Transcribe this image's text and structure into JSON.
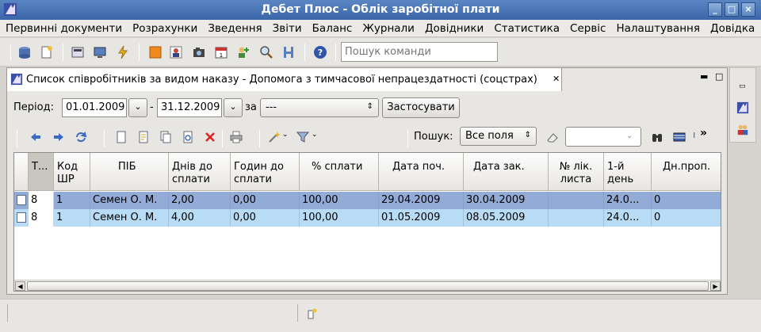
{
  "window": {
    "title": "Дебет Плюс - Облік заробітної плати",
    "controls": [
      "minimize-icon",
      "maximize-icon",
      "close-icon"
    ]
  },
  "menu": [
    "Первинні документи",
    "Розрахунки",
    "Зведення",
    "Звіти",
    "Баланс",
    "Журнали",
    "Довідники",
    "Статистика",
    "Сервіс",
    "Налаштування",
    "Довідка"
  ],
  "toolbar": {
    "icons": [
      "database-icon",
      "new-document-icon",
      "calculator-icon",
      "monitor-icon",
      "lightning-icon",
      "orange-square-icon",
      "photo-icon",
      "camera-icon",
      "calendar-icon",
      "add-user-icon",
      "search-icon",
      "hammer-icon",
      "help-icon"
    ],
    "command_search_placeholder": "Пошук команди"
  },
  "view": {
    "tab_title": "Список співробітників за видом наказу - Допомога з тимчасової непрацездатності (соцстрах)",
    "close_glyph": "✕"
  },
  "period": {
    "label": "Період:",
    "from": "01.01.2009",
    "dash": "-",
    "to": "31.12.2009",
    "for_label": "за",
    "for_value": "---",
    "apply_label": "Застосувати"
  },
  "gridbar": {
    "icons": [
      "arrow-left-icon",
      "arrow-right-icon",
      "refresh-icon",
      "new-icon",
      "edit-icon",
      "copy-icon",
      "duplicate-icon",
      "delete-icon",
      "print-icon",
      "wand-icon",
      "filter-icon"
    ],
    "search_label": "Пошук:",
    "search_scope": "Все поля",
    "search_value": "",
    "more": "»"
  },
  "table": {
    "columns": [
      "Т...",
      "Код ШР",
      "ПІБ",
      "Днів до сплати",
      "Годин до сплати",
      "% сплати",
      "Дата поч.",
      "Дата зак.",
      "№ лік. листа",
      "1-й день",
      "Дн.проп."
    ],
    "rows": [
      [
        "8",
        "1",
        "Семен О. М.",
        "2,00",
        "0,00",
        "100,00",
        "29.04.2009",
        "30.04.2009",
        "",
        "24.0...",
        "0"
      ],
      [
        "8",
        "1",
        "Семен О. М.",
        "4,00",
        "0,00",
        "100,00",
        "01.05.2009",
        "08.05.2009",
        "",
        "24.0...",
        "0"
      ]
    ]
  },
  "colors": {
    "title_bar": "#4a76b8",
    "row_selected": "#93acd7",
    "row_active": "#b8dcf5"
  }
}
